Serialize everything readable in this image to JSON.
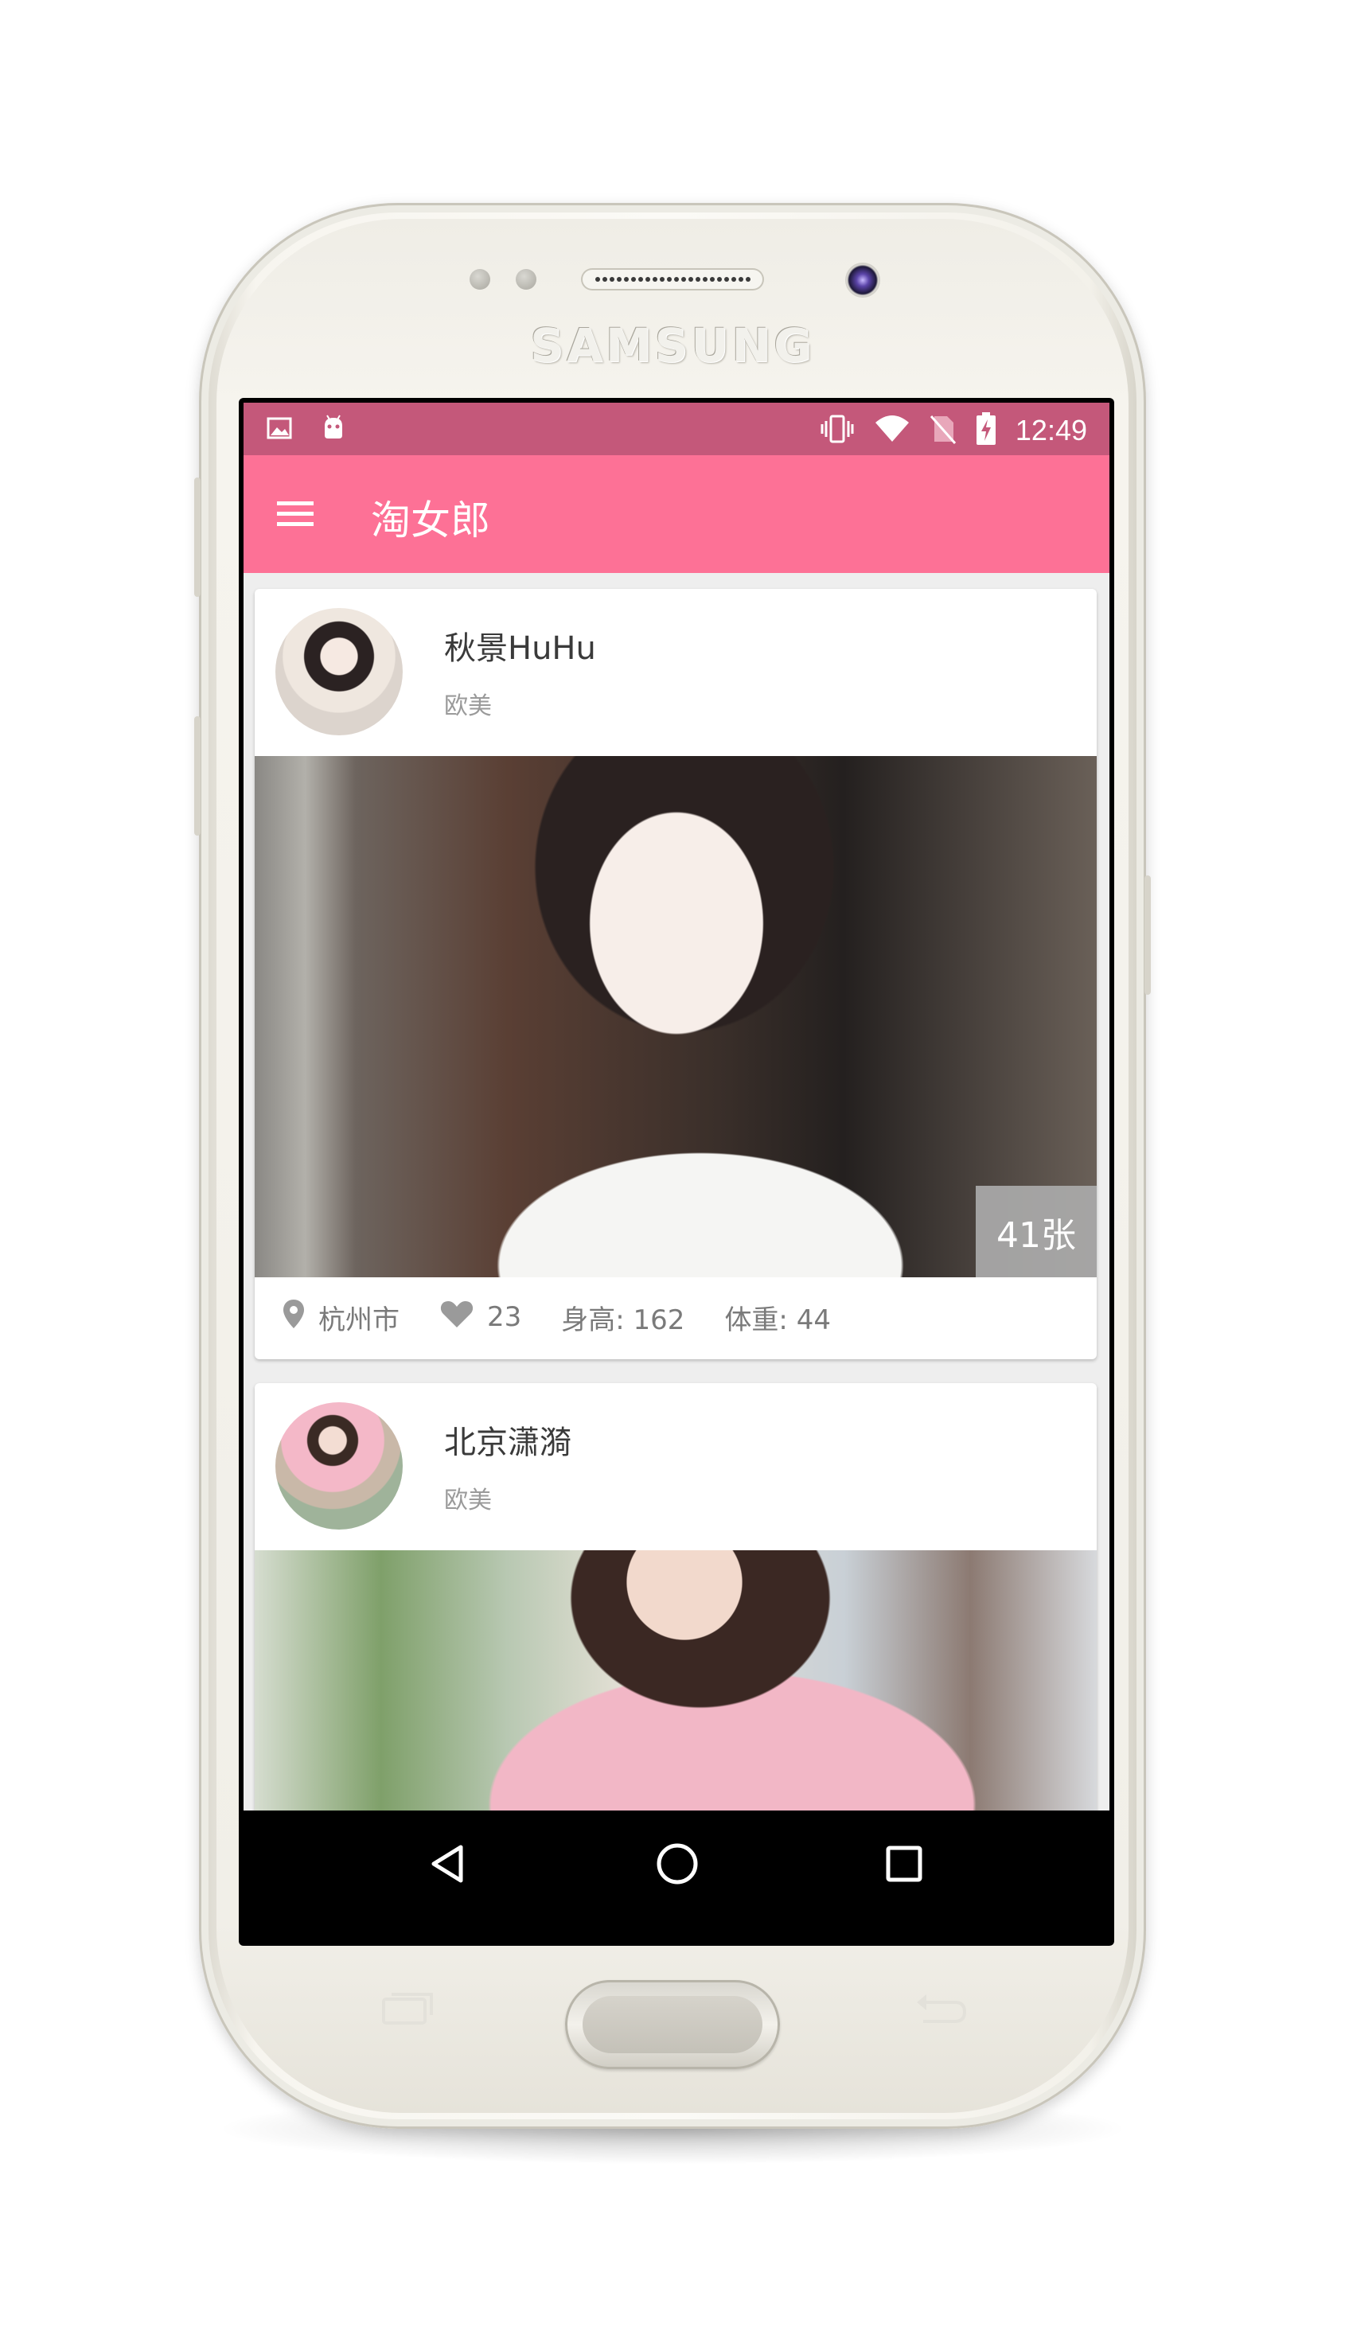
{
  "device": {
    "brand": "SAMSUNG"
  },
  "status_bar": {
    "time": "12:49",
    "left_icons": [
      "image-icon",
      "android-icon"
    ],
    "right_icons": [
      "vibrate-icon",
      "wifi-icon",
      "no-sim-icon",
      "battery-charging-icon"
    ]
  },
  "app_bar": {
    "title": "淘女郎",
    "menu_icon": "hamburger-menu-icon",
    "color": "#fd7196"
  },
  "cards": [
    {
      "name": "秋景HuHu",
      "category": "欧美",
      "photo_count": "41张",
      "city": "杭州市",
      "likes": "23",
      "height": "身高: 162",
      "weight": "体重: 44"
    },
    {
      "name": "北京潇漪",
      "category": "欧美"
    }
  ],
  "nav_bar": {
    "buttons": [
      "back-icon",
      "home-icon",
      "recents-icon"
    ]
  },
  "colors": {
    "status_bar": "#c4587a",
    "accent": "#fd7196",
    "content_bg": "#eeeeee"
  }
}
